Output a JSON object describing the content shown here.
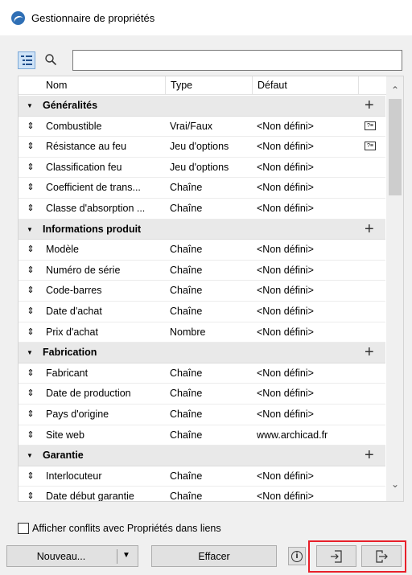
{
  "window": {
    "title": "Gestionnaire de propriétés"
  },
  "search": {
    "value": "",
    "placeholder": ""
  },
  "table": {
    "headers": {
      "name": "Nom",
      "type": "Type",
      "default": "Défaut"
    }
  },
  "groups": [
    {
      "label": "Généralités",
      "rows": [
        {
          "name": "Combustible",
          "type": "Vrai/Faux",
          "default": "<Non défini>",
          "extra": true
        },
        {
          "name": "Résistance au feu",
          "type": "Jeu d'options",
          "default": "<Non défini>",
          "extra": true
        },
        {
          "name": "Classification feu",
          "type": "Jeu d'options",
          "default": "<Non défini>",
          "extra": false
        },
        {
          "name": "Coefficient de trans...",
          "type": "Chaîne",
          "default": "<Non défini>",
          "extra": false
        },
        {
          "name": "Classe d'absorption ...",
          "type": "Chaîne",
          "default": "<Non défini>",
          "extra": false
        }
      ]
    },
    {
      "label": "Informations produit",
      "rows": [
        {
          "name": "Modèle",
          "type": "Chaîne",
          "default": "<Non défini>",
          "extra": false
        },
        {
          "name": "Numéro de série",
          "type": "Chaîne",
          "default": "<Non défini>",
          "extra": false
        },
        {
          "name": "Code-barres",
          "type": "Chaîne",
          "default": "<Non défini>",
          "extra": false
        },
        {
          "name": "Date d'achat",
          "type": "Chaîne",
          "default": "<Non défini>",
          "extra": false
        },
        {
          "name": "Prix d'achat",
          "type": "Nombre",
          "default": "<Non défini>",
          "extra": false
        }
      ]
    },
    {
      "label": "Fabrication",
      "rows": [
        {
          "name": "Fabricant",
          "type": "Chaîne",
          "default": "<Non défini>",
          "extra": false
        },
        {
          "name": "Date de production",
          "type": "Chaîne",
          "default": "<Non défini>",
          "extra": false
        },
        {
          "name": "Pays d'origine",
          "type": "Chaîne",
          "default": "<Non défini>",
          "extra": false
        },
        {
          "name": "Site web",
          "type": "Chaîne",
          "default": "www.archicad.fr",
          "extra": false
        }
      ]
    },
    {
      "label": "Garantie",
      "rows": [
        {
          "name": "Interlocuteur",
          "type": "Chaîne",
          "default": "<Non défini>",
          "extra": false
        },
        {
          "name": "Date début garantie",
          "type": "Chaîne",
          "default": "<Non défini>",
          "extra": false
        }
      ]
    }
  ],
  "icons": {
    "group_add": "plus-icon",
    "row_handle": "drag-handle-icon",
    "group_toggle": "collapse-triangle-icon",
    "option_set": "option-set-icon"
  },
  "footer": {
    "conflict_label": "Afficher conflits avec Propriétés dans liens",
    "conflict_checked": false,
    "new_label": "Nouveau...",
    "clear_label": "Effacer"
  },
  "colors": {
    "highlight": "#e8202a",
    "app_icon": "#2f6fb5",
    "mode_button": "#cfe3f7"
  }
}
